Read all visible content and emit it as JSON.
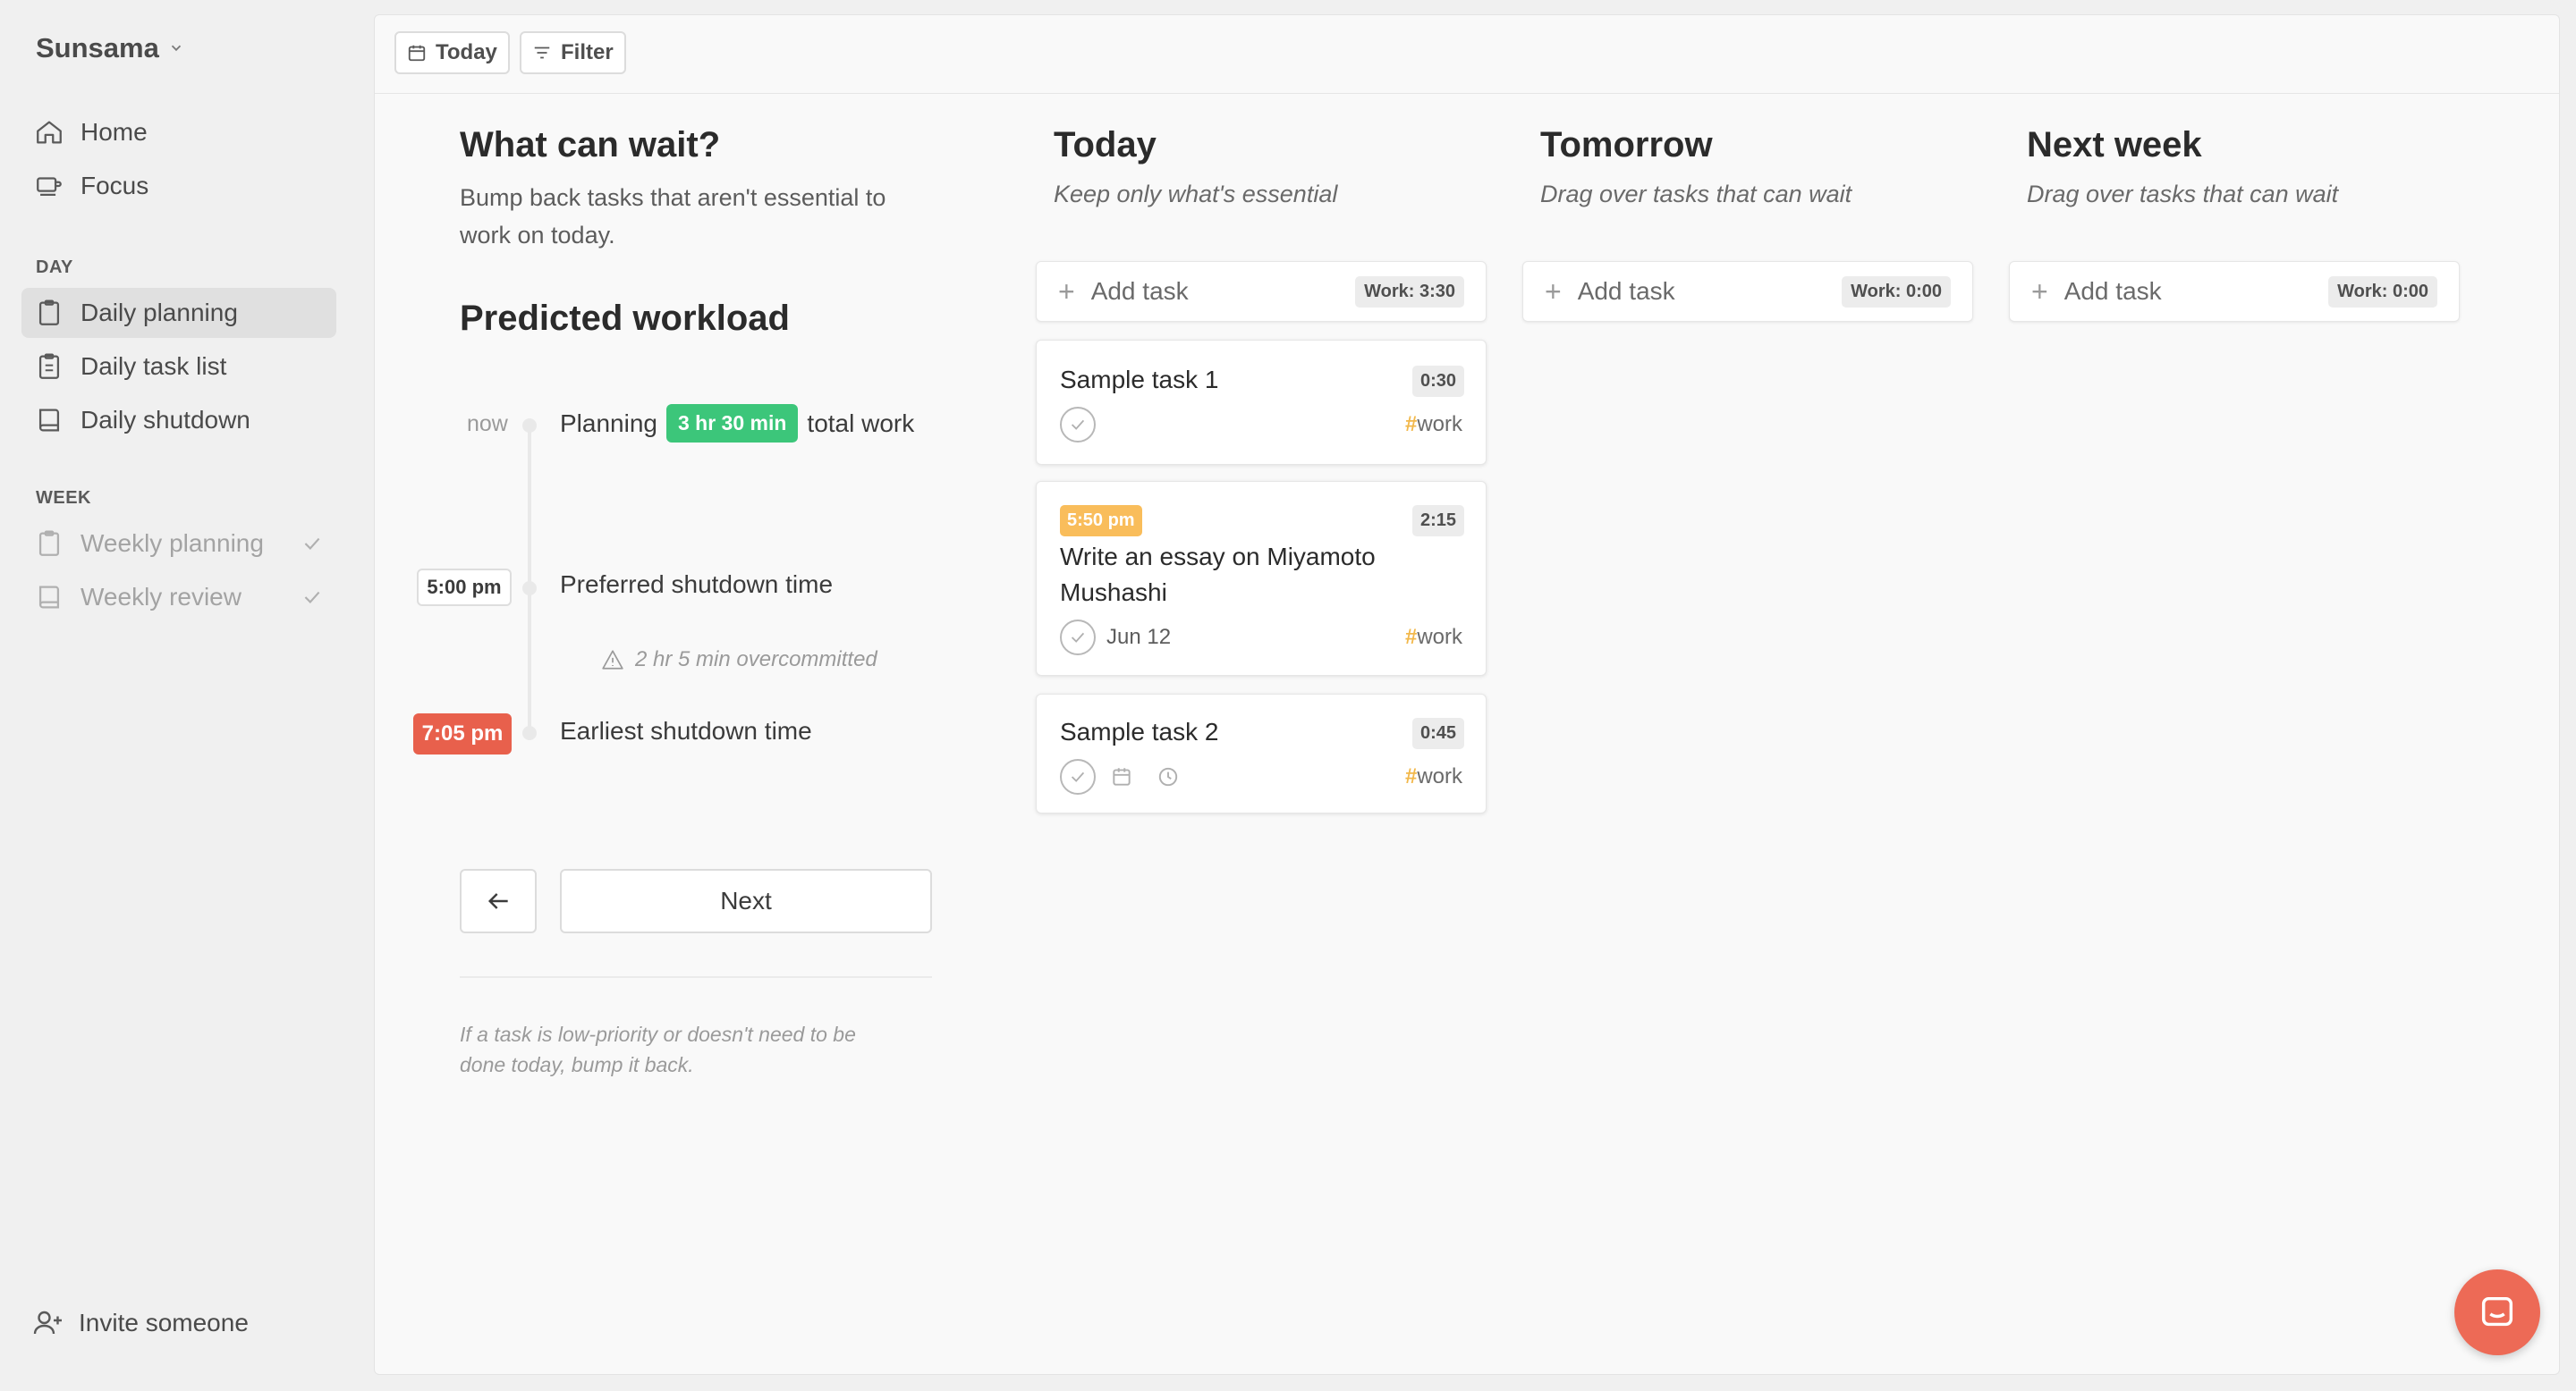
{
  "app": {
    "name": "Sunsama"
  },
  "sidebar": {
    "nav": [
      {
        "label": "Home",
        "icon": "home-icon"
      },
      {
        "label": "Focus",
        "icon": "focus-icon"
      }
    ],
    "day_section": "DAY",
    "day_items": [
      {
        "label": "Daily planning",
        "icon": "clipboard-icon",
        "active": true
      },
      {
        "label": "Daily task list",
        "icon": "clipboard-list-icon"
      },
      {
        "label": "Daily shutdown",
        "icon": "book-icon"
      }
    ],
    "week_section": "WEEK",
    "week_items": [
      {
        "label": "Weekly planning",
        "icon": "clipboard-icon",
        "done": true
      },
      {
        "label": "Weekly review",
        "icon": "book-icon",
        "done": true
      }
    ],
    "invite_label": "Invite someone"
  },
  "toolbar": {
    "today_label": "Today",
    "filter_label": "Filter"
  },
  "info": {
    "title": "What can wait?",
    "description_line1": "Bump back tasks that aren't essential to",
    "description_line2": "work on today.",
    "workload_title": "Predicted workload",
    "now_label": "now",
    "planning_prefix": "Planning",
    "planning_value": "3 hr 30 min",
    "planning_suffix": "total work",
    "preferred_time": "5:00 pm",
    "preferred_label": "Preferred shutdown time",
    "overcommitted": "2 hr 5 min overcommitted",
    "earliest_time": "7:05 pm",
    "earliest_label": "Earliest shutdown time",
    "next_label": "Next",
    "hint_line1": "If a task is low-priority or doesn't need to be",
    "hint_line2": "done today, bump it back."
  },
  "columns": [
    {
      "title": "Today",
      "subtitle": "Keep only what's essential",
      "add_label": "Add task",
      "work": "Work: 3:30"
    },
    {
      "title": "Tomorrow",
      "subtitle": "Drag over tasks that can wait",
      "add_label": "Add task",
      "work": "Work: 0:00"
    },
    {
      "title": "Next week",
      "subtitle": "Drag over tasks that can wait",
      "add_label": "Add task",
      "work": "Work: 0:00"
    }
  ],
  "tasks": [
    {
      "title": "Sample task 1",
      "duration": "0:30",
      "tag": "work"
    },
    {
      "time": "5:50 pm",
      "title_line1": "Write an essay on Miyamoto",
      "title_line2": "Mushashi",
      "duration": "2:15",
      "date": "Jun 12",
      "tag": "work"
    },
    {
      "title": "Sample task 2",
      "duration": "0:45",
      "tag": "work"
    }
  ],
  "colors": {
    "accent_green": "#3cc67a",
    "accent_red": "#e8604c",
    "accent_orange": "#f9bd5b",
    "tag_hash": "#f2b84b",
    "fab": "#ed6a56"
  }
}
